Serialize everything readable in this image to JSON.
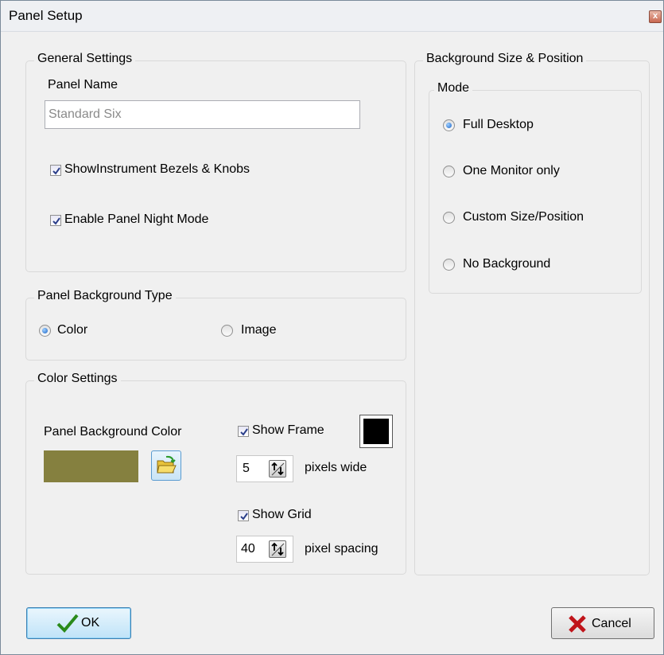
{
  "window": {
    "title": "Panel Setup",
    "close_glyph": "x"
  },
  "general": {
    "group_title": "General Settings",
    "panel_name_label": "Panel Name",
    "panel_name_placeholder": "Standard Six",
    "show_bezels_label": "ShowInstrument Bezels & Knobs",
    "show_bezels_checked": true,
    "night_mode_label": "Enable Panel Night Mode",
    "night_mode_checked": true
  },
  "background_type": {
    "group_title": "Panel Background Type",
    "options": [
      {
        "label": "Color",
        "selected": true
      },
      {
        "label": "Image",
        "selected": false
      }
    ]
  },
  "color_settings": {
    "group_title": "Color Settings",
    "bg_color_label": "Panel Background Color",
    "bg_color": "#85803f",
    "show_frame_label": "Show Frame",
    "show_frame_checked": true,
    "frame_color": "#000000",
    "frame_width_value": "5",
    "frame_width_unit": "pixels wide",
    "show_grid_label": "Show Grid",
    "show_grid_checked": true,
    "grid_spacing_value": "40",
    "grid_spacing_unit": "pixel spacing"
  },
  "bg_size": {
    "group_title": "Background Size & Position",
    "mode_title": "Mode",
    "options": [
      {
        "label": "Full Desktop",
        "selected": true
      },
      {
        "label": "One Monitor only",
        "selected": false
      },
      {
        "label": "Custom Size/Position",
        "selected": false
      },
      {
        "label": "No Background",
        "selected": false
      }
    ]
  },
  "buttons": {
    "ok": "OK",
    "cancel": "Cancel"
  },
  "colors": {
    "accent": "#3c7fb1",
    "check_green": "#2a8a1a",
    "cancel_red": "#c0141a",
    "folder_yellow": "#e8c23a"
  }
}
